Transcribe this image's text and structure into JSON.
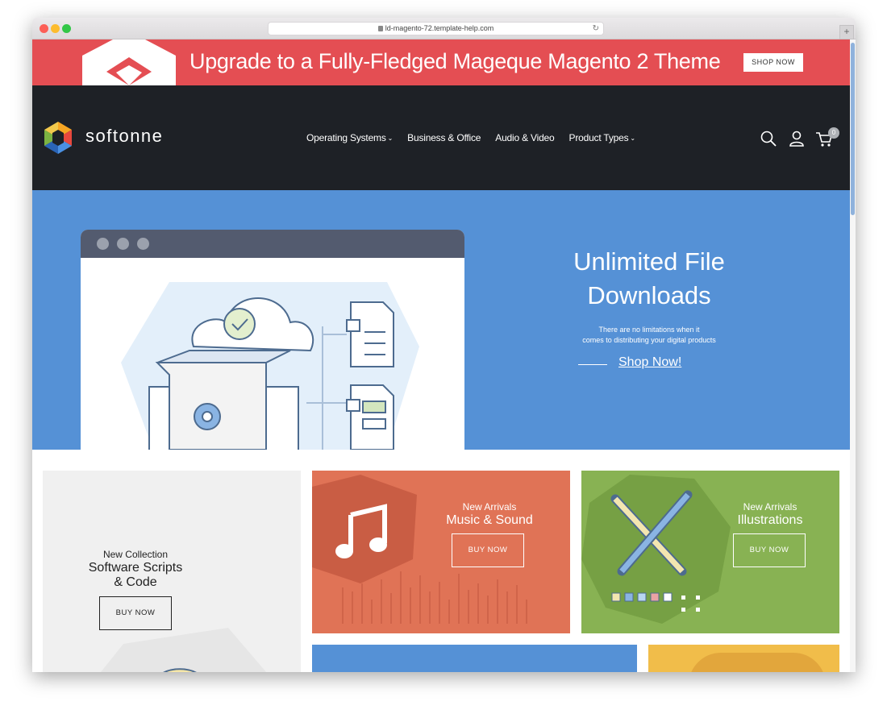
{
  "browser": {
    "url": "ld-magento-72.template-help.com",
    "reload_icon": "reload-icon",
    "new_tab_icon": "plus-icon"
  },
  "promo": {
    "text_prefix": "Upgrade to a Fully-Fledged ",
    "text_strong": "Mageque Magento 2 Theme",
    "button": "SHOP NOW",
    "color": "#e44e53"
  },
  "header": {
    "logo_text": "softonne",
    "nav": [
      {
        "label": "Operating Systems",
        "has_dropdown": true
      },
      {
        "label": "Business & Office",
        "has_dropdown": false
      },
      {
        "label": "Audio & Video",
        "has_dropdown": false
      },
      {
        "label": "Product Types",
        "has_dropdown": true
      }
    ],
    "icons": [
      "search-icon",
      "user-icon",
      "cart-icon"
    ],
    "cart_count": "0",
    "background": "#1e2126"
  },
  "hero": {
    "title_line1": "Unlimited File",
    "title_line2": "Downloads",
    "subtitle_line1": "There are no limitations when it",
    "subtitle_line2": "comes to distributing your digital products",
    "cta": "Shop Now!",
    "background": "#5591d6"
  },
  "cards": {
    "scripts": {
      "eyebrow": "New Collection",
      "title_line1": "Software Scripts",
      "title_line2": "& Code",
      "button": "BUY NOW",
      "background": "#f0f0f0"
    },
    "music": {
      "eyebrow": "New Arrivals",
      "title": "Music & Sound",
      "button": "BUY NOW",
      "background": "#e07356"
    },
    "illustrations": {
      "eyebrow": "New Arrivals",
      "title": "Illustrations",
      "button": "BUY NOW",
      "background": "#88b253"
    }
  }
}
